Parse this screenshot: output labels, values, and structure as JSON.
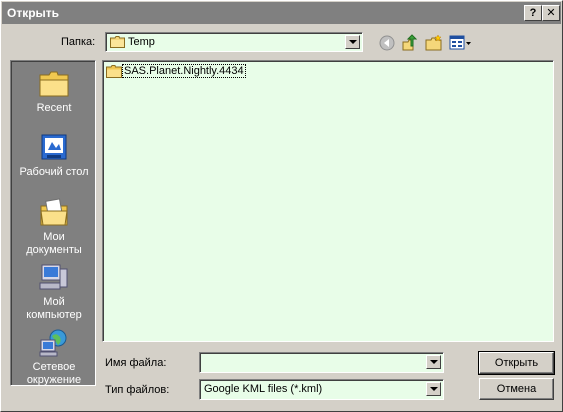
{
  "window": {
    "title": "Открыть",
    "help_label": "?",
    "close_label": "✕"
  },
  "toolbar": {
    "folder_label": "Папка:",
    "folder_value": "Temp"
  },
  "places": [
    {
      "label": "Recent",
      "icon": "recent-folder-icon"
    },
    {
      "label": "Рабочий стол",
      "icon": "desktop-icon"
    },
    {
      "label": "Мои документы",
      "icon": "my-documents-icon"
    },
    {
      "label": "Мой компьютер",
      "icon": "my-computer-icon"
    },
    {
      "label": "Сетевое окружение",
      "icon": "network-icon"
    }
  ],
  "files": [
    {
      "name": "SAS.Planet.Nightly.4434",
      "icon": "folder-icon"
    }
  ],
  "form": {
    "filename_label": "Имя файла:",
    "filename_value": "",
    "filetype_label": "Тип файлов:",
    "filetype_value": "Google KML files (*.kml)"
  },
  "buttons": {
    "open_label": "Открыть",
    "cancel_label": "Отмена"
  },
  "colors": {
    "field_background": "#e8fde8",
    "places_background": "#808080",
    "face": "#d4d0c8"
  }
}
